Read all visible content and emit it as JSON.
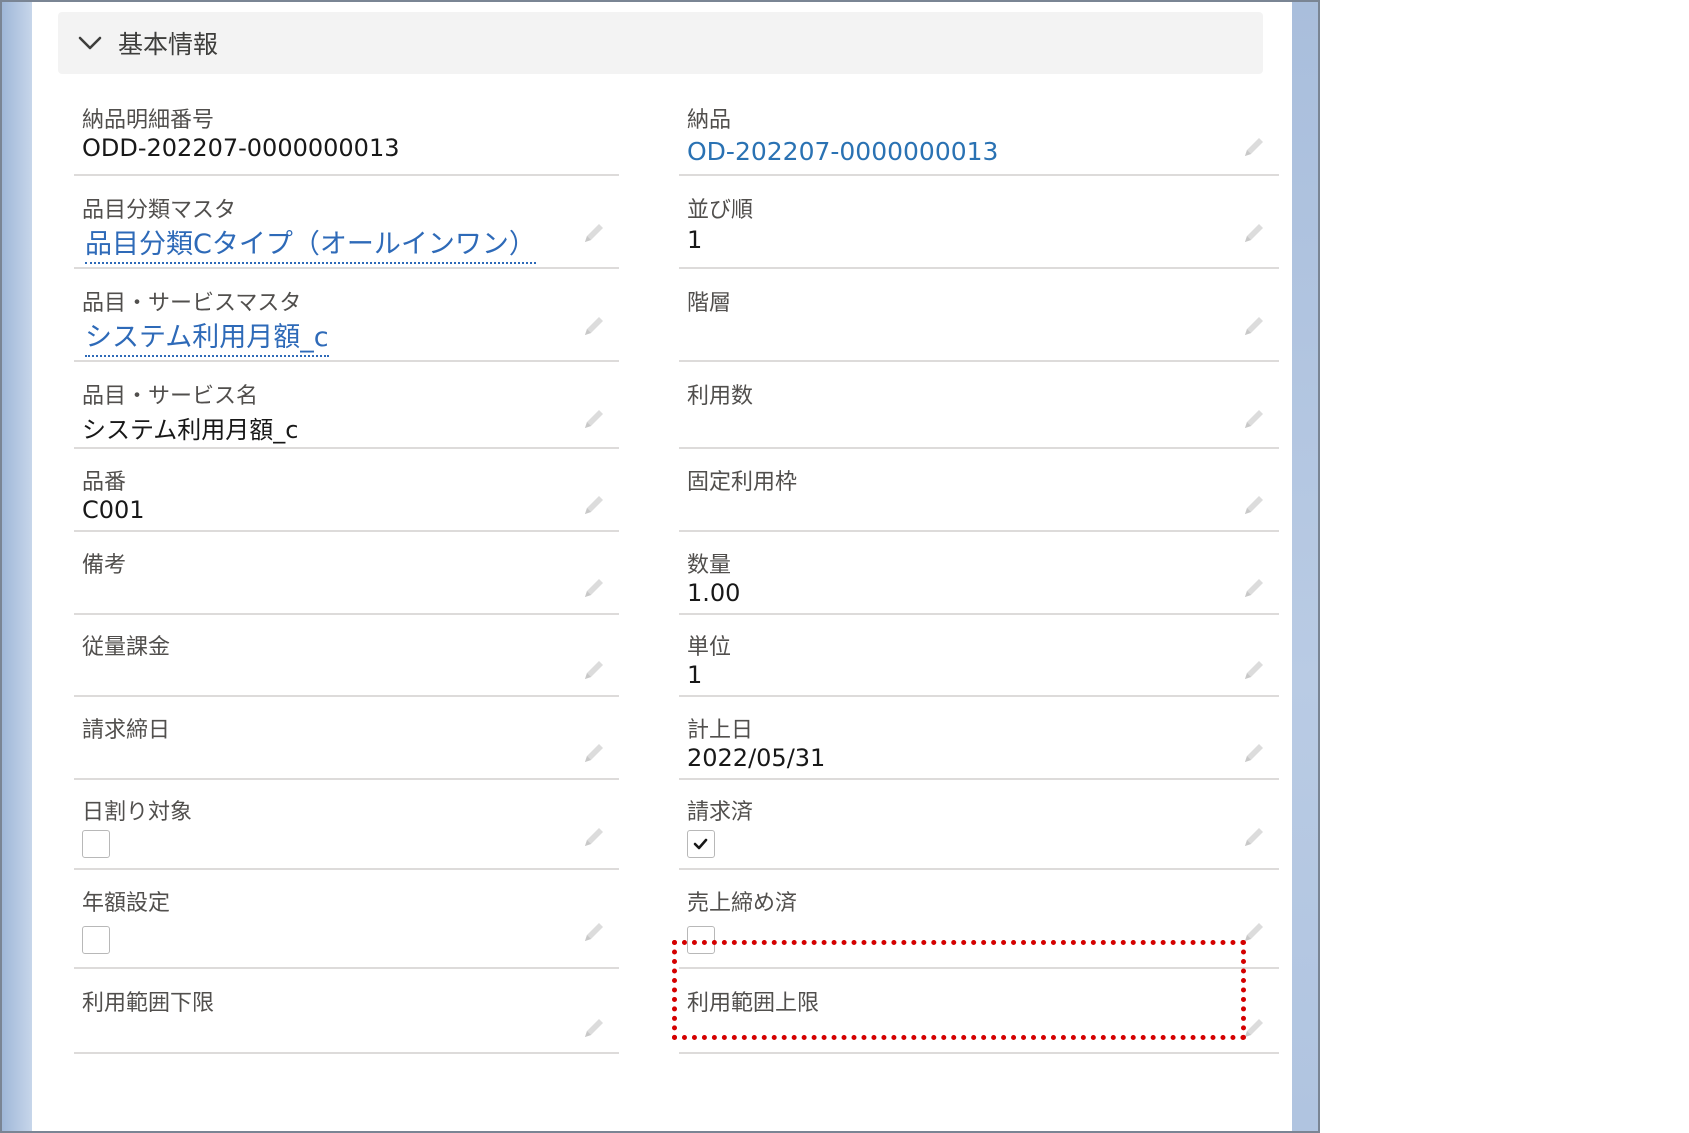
{
  "section": {
    "title": "基本情報"
  },
  "left": [
    {
      "label": "納品明細番号",
      "value": "ODD-202207-0000000013",
      "type": "text"
    },
    {
      "label": "品目分類マスタ",
      "value": "品目分類Cタイプ（オールインワン）",
      "type": "lookup"
    },
    {
      "label": "品目・サービスマスタ",
      "value": "システム利用月額_c",
      "type": "lookup"
    },
    {
      "label": "品目・サービス名",
      "value": "システム利用月額_c",
      "type": "text"
    },
    {
      "label": "品番",
      "value": "C001",
      "type": "text"
    },
    {
      "label": "備考",
      "value": "",
      "type": "text"
    },
    {
      "label": "従量課金",
      "value": "",
      "type": "text"
    },
    {
      "label": "請求締日",
      "value": "",
      "type": "text"
    },
    {
      "label": "日割り対象",
      "checked": false,
      "type": "checkbox"
    },
    {
      "label": "年額設定",
      "checked": false,
      "type": "checkbox"
    },
    {
      "label": "利用範囲下限",
      "value": "",
      "type": "text"
    }
  ],
  "right": [
    {
      "label": "納品",
      "value": "OD-202207-0000000013",
      "type": "link"
    },
    {
      "label": "並び順",
      "value": "1",
      "type": "text"
    },
    {
      "label": "階層",
      "value": "",
      "type": "text"
    },
    {
      "label": "利用数",
      "value": "",
      "type": "text"
    },
    {
      "label": "固定利用枠",
      "value": "",
      "type": "text"
    },
    {
      "label": "数量",
      "value": "1.00",
      "type": "text"
    },
    {
      "label": "単位",
      "value": "1",
      "type": "text"
    },
    {
      "label": "計上日",
      "value": "2022/05/31",
      "type": "text"
    },
    {
      "label": "請求済",
      "checked": true,
      "type": "checkbox"
    },
    {
      "label": "売上締め済",
      "checked": false,
      "type": "checkbox"
    },
    {
      "label": "利用範囲上限",
      "value": "",
      "type": "text"
    }
  ],
  "colors": {
    "link": "#2a72b3",
    "highlight": "#d40000",
    "divider": "#dddbda"
  },
  "icons": {
    "edit": "pencil-icon",
    "collapse": "chevron-down-icon",
    "check": "checkmark-icon"
  }
}
